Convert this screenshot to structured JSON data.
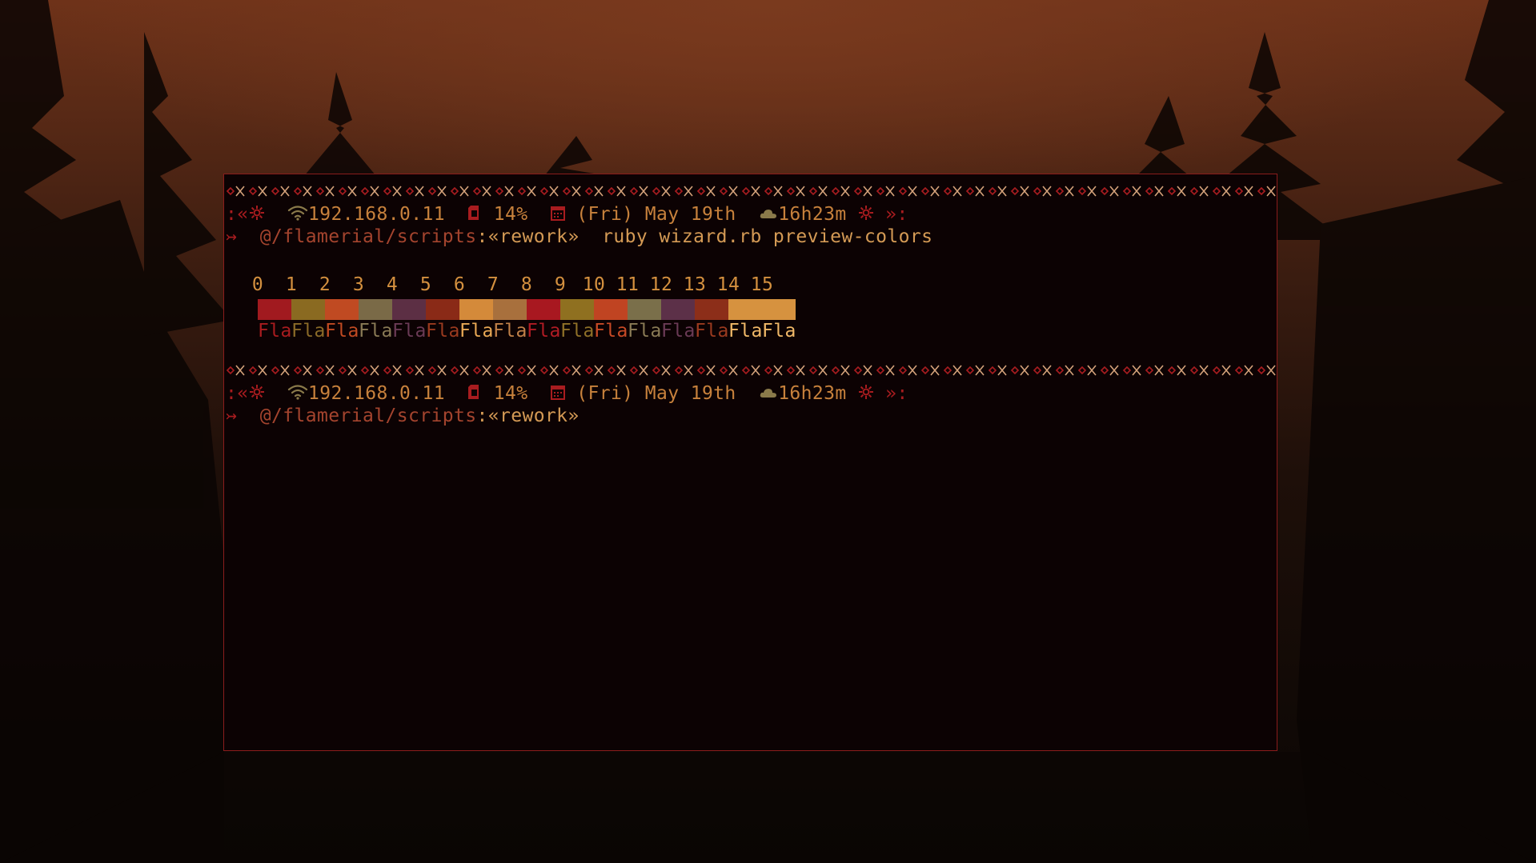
{
  "prompt": {
    "open": ":«",
    "ip": "192.168.0.11",
    "battery": "14%",
    "date": "(Fri) May 19th",
    "uptime": "16h23m",
    "close": "»:",
    "path_arrow": "↣",
    "path": "@/flamerial/scripts",
    "branch_colon": ":",
    "branch": "«rework»",
    "icons": [
      "sun-icon",
      "wifi-icon",
      "sd-card-icon",
      "calendar-icon",
      "cloud-icon",
      "sun-icon"
    ]
  },
  "command": "ruby wizard.rb preview-colors",
  "palette": {
    "indices": [
      "0",
      "1",
      "2",
      "3",
      "4",
      "5",
      "6",
      "7",
      "8",
      "9",
      "10",
      "11",
      "12",
      "13",
      "14",
      "15"
    ],
    "sample_text": "Fla",
    "colors": [
      "#a11a1f",
      "#8a6a21",
      "#c04a22",
      "#7a6a47",
      "#5c2f44",
      "#8a2a17",
      "#d48a3a",
      "#a8703d",
      "#a81820",
      "#8f7020",
      "#c04422",
      "#7a6f4a",
      "#5c3048",
      "#8c2e19",
      "#d6923f",
      "#d6923f"
    ],
    "text_colors": [
      "#a81c1f",
      "#8a6a28",
      "#c04a22",
      "#8a7a55",
      "#6a3a55",
      "#9a3a1f",
      "#e8a855",
      "#c08048",
      "#b01c24",
      "#8f7028",
      "#c84a26",
      "#8a7a55",
      "#6a3a55",
      "#9a3a1f",
      "#f0b868",
      "#f0b868"
    ]
  },
  "colors": {
    "terminal_bg": "#0c0203",
    "border": "#8a1c1c",
    "prompt_text": "#d4903f",
    "path": "#a4442e"
  }
}
